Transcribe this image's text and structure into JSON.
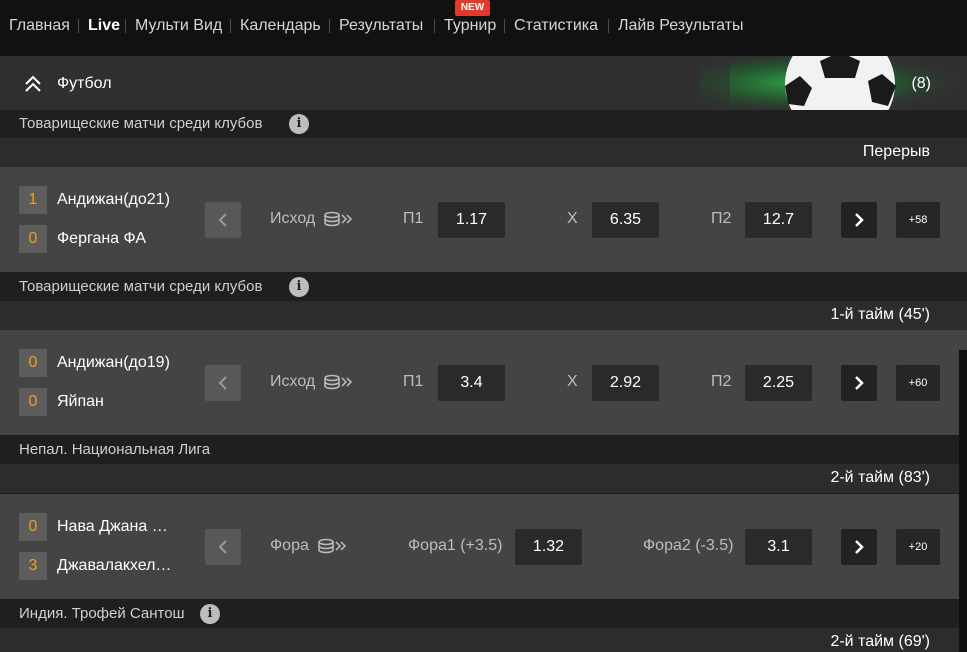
{
  "nav": {
    "items": [
      {
        "label": "Главная"
      },
      {
        "label": "Live"
      },
      {
        "label": "Мульти Вид"
      },
      {
        "label": "Календарь"
      },
      {
        "label": "Результаты"
      },
      {
        "label": "Турнир"
      },
      {
        "label": "Статистика"
      },
      {
        "label": "Лайв Результаты"
      }
    ],
    "badge": "NEW"
  },
  "sport": {
    "title": "Футбол",
    "count": "(8)"
  },
  "leagues": [
    {
      "name": "Товарищеские матчи среди клубов",
      "status": "Перерыв"
    },
    {
      "name": "Товарищеские матчи среди клубов",
      "status": "1-й тайм  (45')"
    },
    {
      "name": "Непал. Национальная Лига",
      "status": "2-й тайм  (83')"
    },
    {
      "name": "Индия. Трофей Сантош",
      "status": "2-й тайм  (69')"
    }
  ],
  "matches": [
    {
      "home": {
        "score": "1",
        "name": "Андижан(до21)"
      },
      "away": {
        "score": "0",
        "name": "Фергана ФА"
      },
      "market": "Исход",
      "o1_label": "П1",
      "o1": "1.17",
      "o2_label": "Х",
      "o2": "6.35",
      "o3_label": "П2",
      "o3": "12.7",
      "more": "+58"
    },
    {
      "home": {
        "score": "0",
        "name": "Андижан(до19)"
      },
      "away": {
        "score": "0",
        "name": "Яйпан"
      },
      "market": "Исход",
      "o1_label": "П1",
      "o1": "3.4",
      "o2_label": "Х",
      "o2": "2.92",
      "o3_label": "П2",
      "o3": "2.25",
      "more": "+60"
    },
    {
      "home": {
        "score": "0",
        "name": "Нава Джана Джа..."
      },
      "away": {
        "score": "3",
        "name": "Джавалакхельский..."
      },
      "market": "Фора",
      "o1_label": "Фора1 (+3.5)",
      "o1": "1.32",
      "o2_label": "Фора2 (-3.5)",
      "o2": "3.1",
      "more": "+20"
    }
  ],
  "colors": {
    "accent_score": "#f0a020",
    "badge": "#e23a2a"
  }
}
